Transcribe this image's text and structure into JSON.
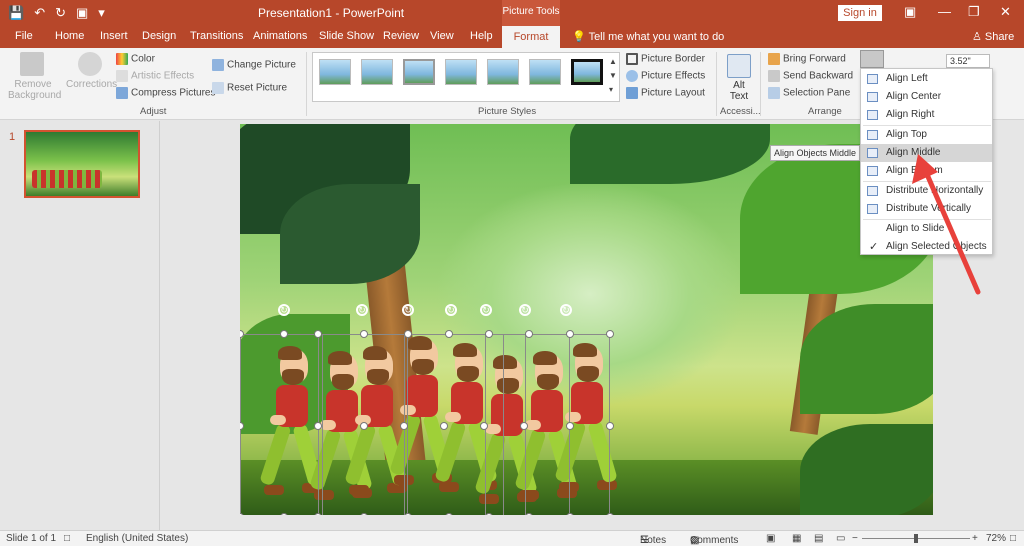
{
  "titlebar": {
    "title": "Presentation1 - PowerPoint",
    "contextual_tab": "Picture Tools",
    "signin": "Sign in"
  },
  "tabs": [
    "File",
    "Home",
    "Insert",
    "Design",
    "Transitions",
    "Animations",
    "Slide Show",
    "Review",
    "View",
    "Help",
    "Format"
  ],
  "tellme": "Tell me what you want to do",
  "share": "Share",
  "ribbon": {
    "remove_background": "Remove Background",
    "corrections": "Corrections",
    "color": "Color",
    "artistic_effects": "Artistic Effects",
    "compress_pictures": "Compress Pictures",
    "change_picture": "Change Picture",
    "reset_picture": "Reset Picture",
    "adjust_label": "Adjust",
    "picture_styles_label": "Picture Styles",
    "picture_border": "Picture Border",
    "picture_effects": "Picture Effects",
    "picture_layout": "Picture Layout",
    "alt_text": "Alt Text",
    "accessibility_label": "Accessi...",
    "bring_forward": "Bring Forward",
    "send_backward": "Send Backward",
    "selection_pane": "Selection Pane",
    "arrange_label": "Arrange",
    "size_value": "3.52\""
  },
  "slide_panel": {
    "slide_number": "1"
  },
  "align_menu": {
    "items": [
      "Align Left",
      "Align Center",
      "Align Right",
      "Align Top",
      "Align Middle",
      "Align Bottom",
      "Distribute Horizontally",
      "Distribute Vertically",
      "Align to Slide",
      "Align Selected Objects"
    ],
    "highlighted": "Align Middle",
    "checked": "Align Selected Objects"
  },
  "tooltip": "Align Objects Middle",
  "statusbar": {
    "slide_info": "Slide 1 of 1",
    "language": "English (United States)",
    "notes": "Notes",
    "comments": "Comments",
    "zoom": "72%"
  },
  "colors": {
    "accent": "#b7472a",
    "ribbon_bg": "#f3f3f3",
    "arrow": "#e8413b"
  }
}
